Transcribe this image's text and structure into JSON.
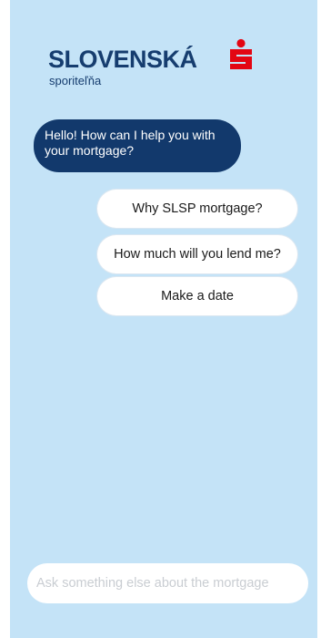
{
  "brand": {
    "wordmark": "SLOVENSKÁ",
    "subtext": "sporiteľňa",
    "logo_icon": "s-logo-icon",
    "colors": {
      "navy": "#163d6f",
      "red": "#e30613",
      "panel": "#c4e3f7"
    }
  },
  "chat": {
    "bot_message": "Hello! How can I help you with your mortgage?",
    "options": [
      "Why SLSP mortgage?",
      "How much will you lend me?",
      "Make a date"
    ]
  },
  "composer": {
    "placeholder": "Ask something else about the mortgage",
    "value": ""
  }
}
